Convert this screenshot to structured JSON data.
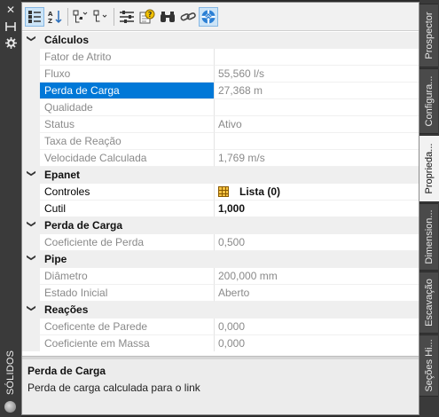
{
  "left_strip": {
    "title": "SÓLIDOS",
    "buttons": [
      "close-icon",
      "pin-icon",
      "settings-icon"
    ]
  },
  "toolbar": {
    "buttons": [
      {
        "name": "categorized-icon",
        "active": true
      },
      {
        "name": "sort-alpha-icon",
        "active": false
      },
      {
        "name": "expand-icon",
        "active": false
      },
      {
        "name": "filter-icon",
        "active": false
      },
      {
        "name": "properties-settings-icon",
        "active": false
      },
      {
        "name": "help-icon",
        "active": false
      },
      {
        "name": "binoculars-icon",
        "active": false
      },
      {
        "name": "link-icon",
        "active": false
      },
      {
        "name": "lifebuoy-icon",
        "active": true
      }
    ]
  },
  "categories": [
    {
      "title": "Cálculos",
      "rows": [
        {
          "name": "Fator de Atrito",
          "value": "",
          "readonly": true
        },
        {
          "name": "Fluxo",
          "value": "55,560 l/s",
          "readonly": true
        },
        {
          "name": "Perda de Carga",
          "value": "27,368 m",
          "readonly": true,
          "selected": true
        },
        {
          "name": "Qualidade",
          "value": "",
          "readonly": true
        },
        {
          "name": "Status",
          "value": "Ativo",
          "readonly": true
        },
        {
          "name": "Taxa de Reação",
          "value": "",
          "readonly": true
        },
        {
          "name": "Velocidade Calculada",
          "value": "1,769 m/s",
          "readonly": true
        }
      ]
    },
    {
      "title": "Epanet",
      "rows": [
        {
          "name": "Controles",
          "value": "Lista (0)",
          "readonly": false,
          "bold": true,
          "icon": "table-grid-icon"
        },
        {
          "name": "Cutil",
          "value": "1,000",
          "readonly": false,
          "bold": true
        }
      ]
    },
    {
      "title": "Perda de Carga",
      "rows": [
        {
          "name": "Coeficiente de Perda",
          "value": "0,500",
          "readonly": true
        }
      ]
    },
    {
      "title": "Pipe",
      "rows": [
        {
          "name": "Diâmetro",
          "value": "200,000 mm",
          "readonly": true
        },
        {
          "name": "Estado Inicial",
          "value": "Aberto",
          "readonly": true
        }
      ]
    },
    {
      "title": "Reações",
      "rows": [
        {
          "name": "Coeficente de Parede",
          "value": "0,000",
          "readonly": true
        },
        {
          "name": "Coeficiente em Massa",
          "value": "0,000",
          "readonly": true
        }
      ]
    }
  ],
  "description": {
    "title": "Perda de Carga",
    "text": "Perda de carga calculada para o link"
  },
  "right_tabs": [
    {
      "label": "Prospector",
      "active": false
    },
    {
      "label": "Configura...",
      "active": false
    },
    {
      "label": "Proprieda...",
      "active": true
    },
    {
      "label": "Dimension...",
      "active": false
    },
    {
      "label": "Escavação",
      "active": false
    },
    {
      "label": "Seções Hi...",
      "active": false
    }
  ],
  "colors": {
    "selection": "#0078d7",
    "category_bg": "#efefef",
    "readonly_text": "#8a8a8a",
    "dark_chrome": "#3a3a3a"
  }
}
